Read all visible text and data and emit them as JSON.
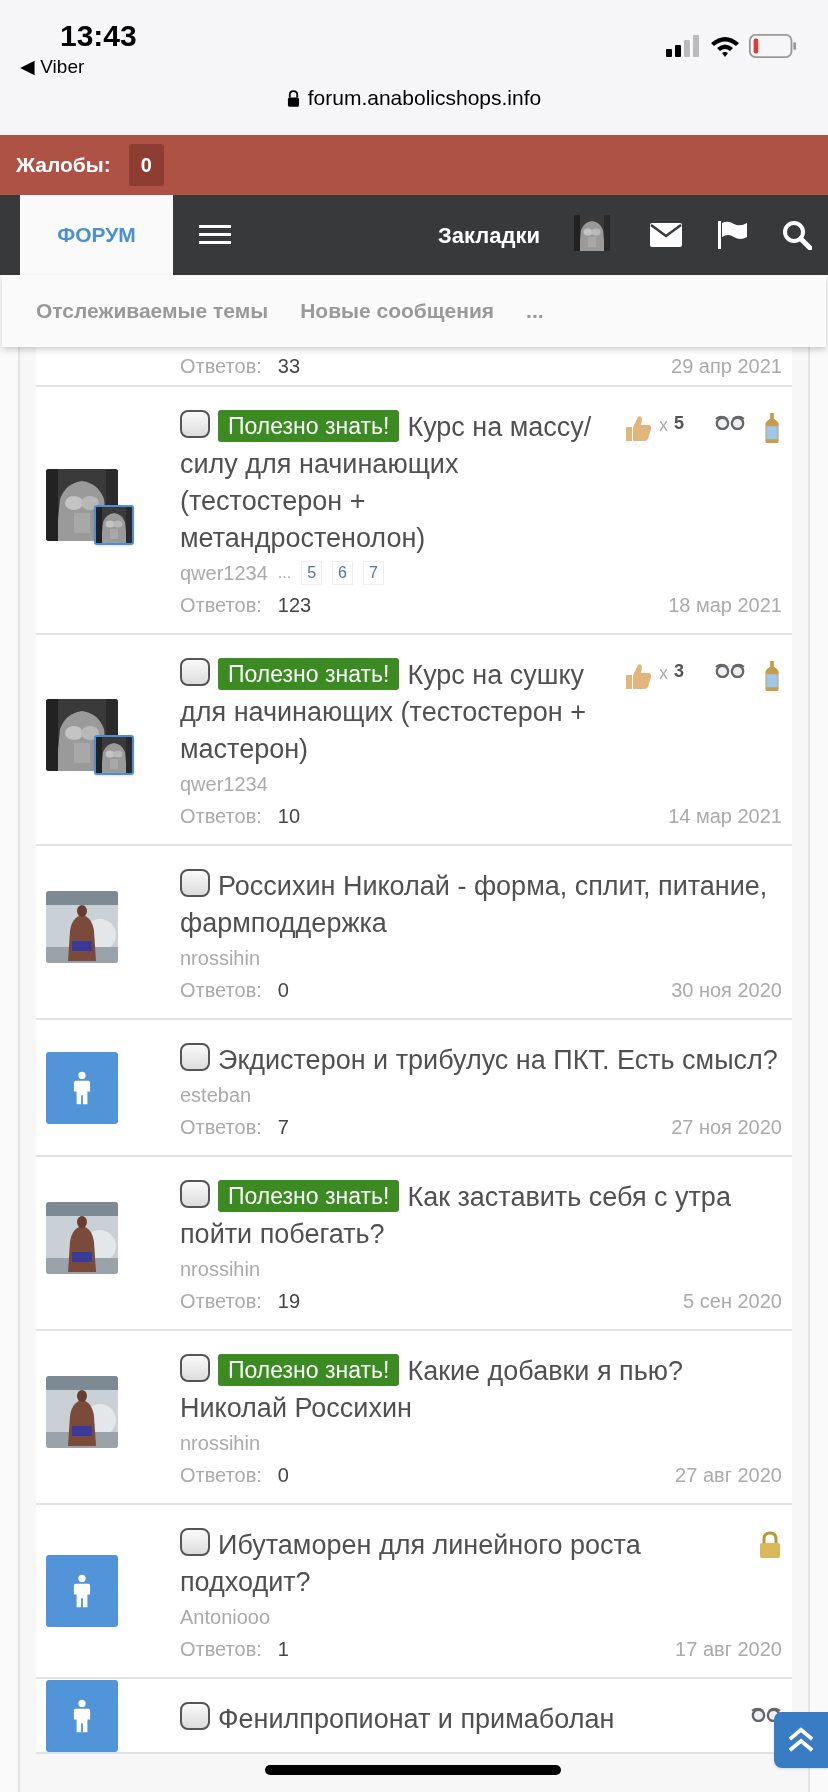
{
  "status_bar": {
    "time": "13:43",
    "back_app": "◀ Viber",
    "url": "forum.anabolicshops.info"
  },
  "reports": {
    "label": "Жалобы:",
    "count": "0"
  },
  "nav": {
    "tabs": [
      {
        "label": "ФОРУМ",
        "selected": true
      }
    ],
    "bookmarks": "Закладки"
  },
  "subnav": [
    "Отслеживаемые темы",
    "Новые сообщения",
    "..."
  ],
  "partial_row": {
    "replies_label": "Ответов:",
    "replies": "33",
    "date": "29 апр 2021"
  },
  "threads": [
    {
      "avatar": {
        "kind": "picture"
      },
      "last_poster_avatar": true,
      "checked": false,
      "prefix": "Полезно знать!",
      "title": "Курс на массу/силу для начинающих (тестостерон + метандростенолон)",
      "author": "qwer1234",
      "pages": [
        "...",
        "5",
        "6",
        "7"
      ],
      "replies_label": "Ответов:",
      "replies": "123",
      "date": "18 мар 2021",
      "likes": "5",
      "likes_prefix": "x",
      "marks": [
        {
          "kind": "watched"
        },
        {
          "kind": "bottle"
        }
      ]
    },
    {
      "avatar": {
        "kind": "picture"
      },
      "last_poster_avatar": true,
      "checked": false,
      "prefix": "Полезно знать!",
      "title": "Курс на сушку для начинающих (тестостерон + мастерон)",
      "author": "qwer1234",
      "replies_label": "Ответов:",
      "replies": "10",
      "date": "14 мар 2021",
      "likes": "3",
      "likes_prefix": "x",
      "marks": [
        {
          "kind": "watched"
        },
        {
          "kind": "bottle"
        }
      ]
    },
    {
      "avatar": {
        "kind": "picture"
      },
      "last_poster_avatar": false,
      "checked": false,
      "title": "Россихин Николай - форма, сплит, питание, фармподдержка",
      "author": "nrossihin",
      "replies_label": "Ответов:",
      "replies": "0",
      "date": "30 ноя 2020"
    },
    {
      "avatar": {
        "kind": "default"
      },
      "last_poster_avatar": false,
      "checked": false,
      "title": "Экдистерон и трибулус на ПКТ. Есть смысл?",
      "author": "esteban",
      "replies_label": "Ответов:",
      "replies": "7",
      "date": "27 ноя 2020"
    },
    {
      "avatar": {
        "kind": "picture"
      },
      "last_poster_avatar": false,
      "checked": false,
      "prefix": "Полезно знать!",
      "title": "Как заставить себя с утра пойти побегать?",
      "author": "nrossihin",
      "replies_label": "Ответов:",
      "replies": "19",
      "date": "5 сен 2020"
    },
    {
      "avatar": {
        "kind": "picture"
      },
      "last_poster_avatar": false,
      "checked": false,
      "prefix": "Полезно знать!",
      "title": "Какие добавки я пью? Николай Россихин",
      "author": "nrossihin",
      "replies_label": "Ответов:",
      "replies": "0",
      "date": "27 авг 2020"
    },
    {
      "avatar": {
        "kind": "default"
      },
      "last_poster_avatar": false,
      "checked": false,
      "title": "Ибутаморен для линейного роста подходит?",
      "author": "Antoniooo",
      "replies_label": "Ответов:",
      "replies": "1",
      "date": "17 авг 2020",
      "marks": [
        {
          "kind": "locked"
        }
      ]
    },
    {
      "avatar": {
        "kind": "default"
      },
      "last_poster_avatar": false,
      "checked": false,
      "title": "Фенилпропионат и примаболан",
      "marks": [
        {
          "kind": "watched"
        }
      ]
    }
  ]
}
